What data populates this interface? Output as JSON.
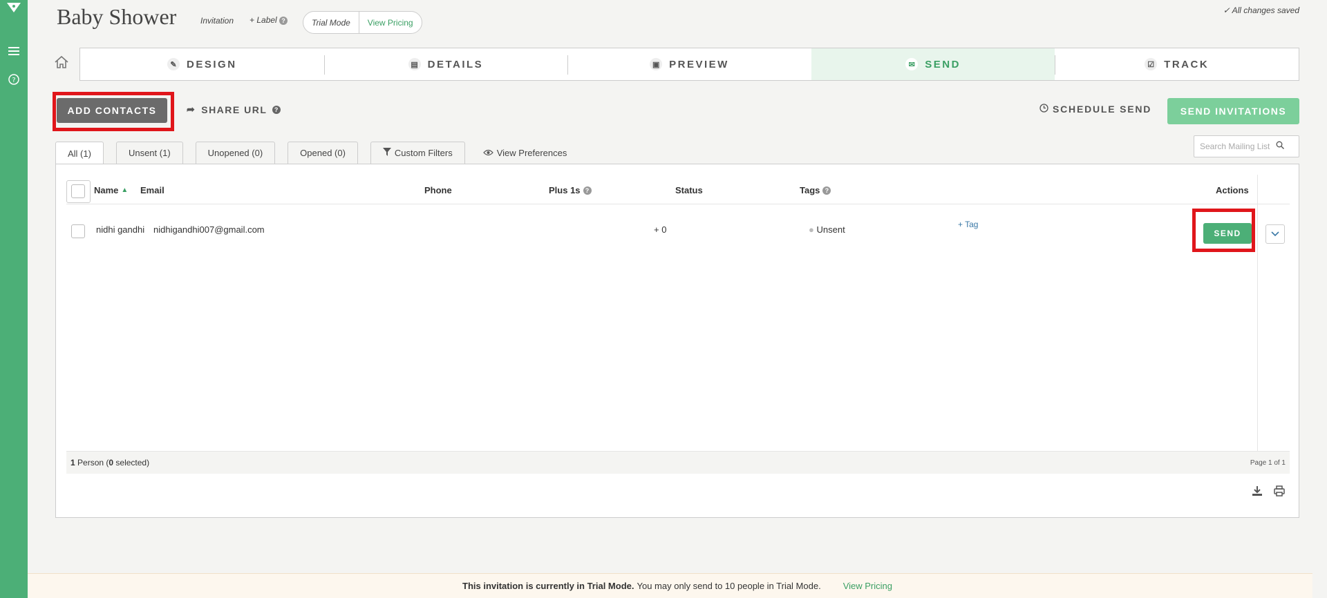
{
  "sidebar": {
    "logo_icon": "evite-logo-icon",
    "menu_icon": "hamburger-icon",
    "help_icon": "question-circle-icon",
    "bg_color": "#4caf77"
  },
  "header": {
    "title": "Baby Shower",
    "type_label": "Invitation",
    "add_label": "+ Label",
    "trial_mode": "Trial Mode",
    "view_pricing": "View Pricing",
    "saved_status": "All changes saved"
  },
  "steps": [
    {
      "label": "DESIGN",
      "icon": "edit-icon"
    },
    {
      "label": "DETAILS",
      "icon": "document-icon"
    },
    {
      "label": "PREVIEW",
      "icon": "image-icon"
    },
    {
      "label": "SEND",
      "icon": "envelope-icon",
      "active": true
    },
    {
      "label": "TRACK",
      "icon": "check-square-icon"
    }
  ],
  "actions": {
    "add_contacts": "ADD CONTACTS",
    "share_url": "SHARE URL",
    "schedule_send": "SCHEDULE SEND",
    "send_invitations": "SEND INVITATIONS"
  },
  "filters": {
    "tabs": [
      "All (1)",
      "Unsent (1)",
      "Unopened (0)",
      "Opened (0)"
    ],
    "custom_filters": "Custom Filters",
    "view_preferences": "View Preferences"
  },
  "search": {
    "placeholder": "Search Mailing List"
  },
  "table": {
    "columns": {
      "name": "Name",
      "email": "Email",
      "phone": "Phone",
      "plus1s": "Plus 1s",
      "status": "Status",
      "tags": "Tags",
      "actions": "Actions"
    },
    "rows": [
      {
        "name": "nidhi gandhi",
        "email": "nidhigandhi007@gmail.com",
        "phone": "",
        "plus1s": "+ 0",
        "status": "Unsent",
        "tag_action": "+ Tag",
        "send_label": "SEND"
      }
    ],
    "footer": {
      "count_prefix": "1",
      "count_mid": " Person (",
      "selected": "0",
      "count_suffix": " selected)",
      "page": "Page 1 of 1"
    }
  },
  "trial_banner": {
    "bold": "This invitation is currently in Trial Mode.",
    "text": "You may only send to 10 people in Trial Mode.",
    "link": "View Pricing"
  },
  "colors": {
    "accent": "#4caf77",
    "highlight": "#e0161b"
  }
}
